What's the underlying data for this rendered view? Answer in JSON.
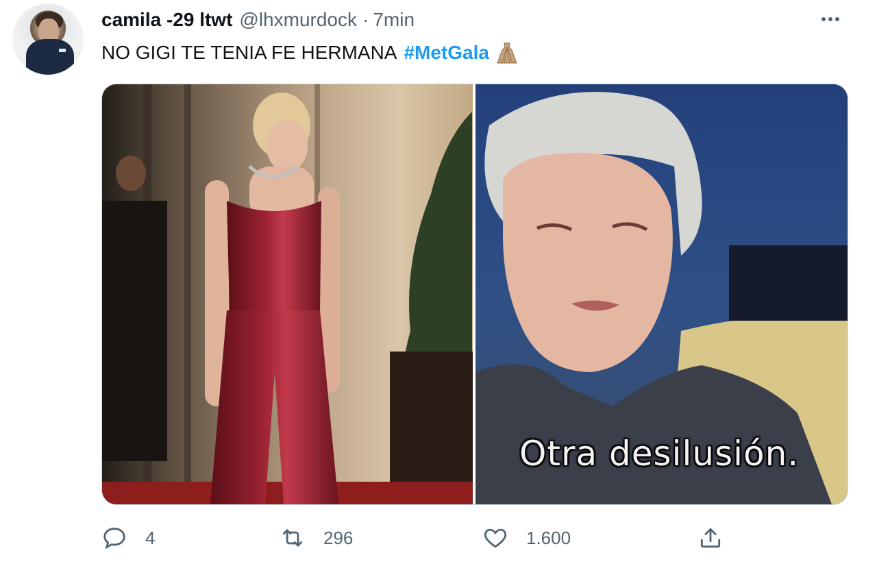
{
  "author": {
    "display_name": "camila -29 ltwt",
    "handle": "@lhxmurdock",
    "separator": "·",
    "timestamp": "7min",
    "avatar_icon": "profile-avatar"
  },
  "tweet": {
    "text": "NO GIGI TE TENIA FE HERMANA",
    "hashtag": "#MetGala",
    "emoji": "dress-emoji"
  },
  "media": {
    "photos": [
      {
        "subject": "red-carpet-photo"
      },
      {
        "subject": "meme-still",
        "subtitle": "Otra desilusión."
      }
    ]
  },
  "actions": {
    "reply": {
      "icon": "reply-icon",
      "count": "4"
    },
    "retweet": {
      "icon": "retweet-icon",
      "count": "296"
    },
    "like": {
      "icon": "heart-icon",
      "count": "1.600"
    },
    "share": {
      "icon": "share-icon"
    }
  },
  "more_menu": {
    "icon": "more-dots-icon"
  },
  "colors": {
    "text_primary": "#0f1419",
    "text_secondary": "#536471",
    "link": "#1d9bf0",
    "border": "#cfd9de"
  }
}
